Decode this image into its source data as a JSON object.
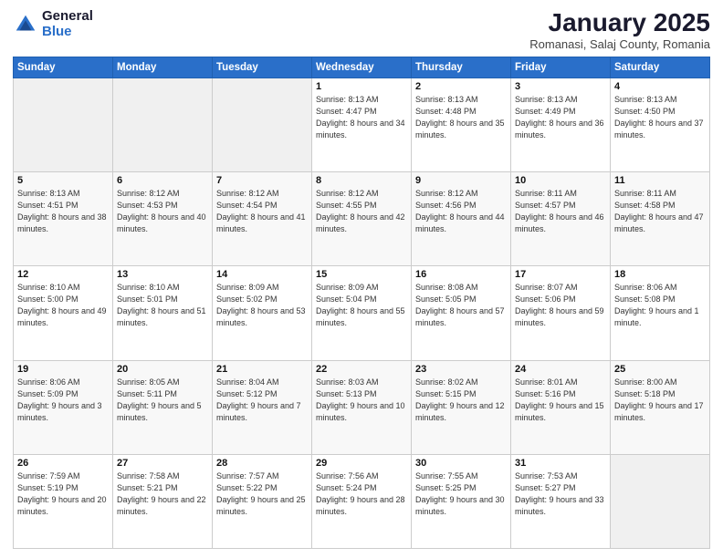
{
  "header": {
    "logo_general": "General",
    "logo_blue": "Blue",
    "month_title": "January 2025",
    "location": "Romanasi, Salaj County, Romania"
  },
  "days_of_week": [
    "Sunday",
    "Monday",
    "Tuesday",
    "Wednesday",
    "Thursday",
    "Friday",
    "Saturday"
  ],
  "weeks": [
    [
      {
        "day": "",
        "sunrise": "",
        "sunset": "",
        "daylight": "",
        "empty": true
      },
      {
        "day": "",
        "sunrise": "",
        "sunset": "",
        "daylight": "",
        "empty": true
      },
      {
        "day": "",
        "sunrise": "",
        "sunset": "",
        "daylight": "",
        "empty": true
      },
      {
        "day": "1",
        "sunrise": "Sunrise: 8:13 AM",
        "sunset": "Sunset: 4:47 PM",
        "daylight": "Daylight: 8 hours and 34 minutes."
      },
      {
        "day": "2",
        "sunrise": "Sunrise: 8:13 AM",
        "sunset": "Sunset: 4:48 PM",
        "daylight": "Daylight: 8 hours and 35 minutes."
      },
      {
        "day": "3",
        "sunrise": "Sunrise: 8:13 AM",
        "sunset": "Sunset: 4:49 PM",
        "daylight": "Daylight: 8 hours and 36 minutes."
      },
      {
        "day": "4",
        "sunrise": "Sunrise: 8:13 AM",
        "sunset": "Sunset: 4:50 PM",
        "daylight": "Daylight: 8 hours and 37 minutes."
      }
    ],
    [
      {
        "day": "5",
        "sunrise": "Sunrise: 8:13 AM",
        "sunset": "Sunset: 4:51 PM",
        "daylight": "Daylight: 8 hours and 38 minutes."
      },
      {
        "day": "6",
        "sunrise": "Sunrise: 8:12 AM",
        "sunset": "Sunset: 4:53 PM",
        "daylight": "Daylight: 8 hours and 40 minutes."
      },
      {
        "day": "7",
        "sunrise": "Sunrise: 8:12 AM",
        "sunset": "Sunset: 4:54 PM",
        "daylight": "Daylight: 8 hours and 41 minutes."
      },
      {
        "day": "8",
        "sunrise": "Sunrise: 8:12 AM",
        "sunset": "Sunset: 4:55 PM",
        "daylight": "Daylight: 8 hours and 42 minutes."
      },
      {
        "day": "9",
        "sunrise": "Sunrise: 8:12 AM",
        "sunset": "Sunset: 4:56 PM",
        "daylight": "Daylight: 8 hours and 44 minutes."
      },
      {
        "day": "10",
        "sunrise": "Sunrise: 8:11 AM",
        "sunset": "Sunset: 4:57 PM",
        "daylight": "Daylight: 8 hours and 46 minutes."
      },
      {
        "day": "11",
        "sunrise": "Sunrise: 8:11 AM",
        "sunset": "Sunset: 4:58 PM",
        "daylight": "Daylight: 8 hours and 47 minutes."
      }
    ],
    [
      {
        "day": "12",
        "sunrise": "Sunrise: 8:10 AM",
        "sunset": "Sunset: 5:00 PM",
        "daylight": "Daylight: 8 hours and 49 minutes."
      },
      {
        "day": "13",
        "sunrise": "Sunrise: 8:10 AM",
        "sunset": "Sunset: 5:01 PM",
        "daylight": "Daylight: 8 hours and 51 minutes."
      },
      {
        "day": "14",
        "sunrise": "Sunrise: 8:09 AM",
        "sunset": "Sunset: 5:02 PM",
        "daylight": "Daylight: 8 hours and 53 minutes."
      },
      {
        "day": "15",
        "sunrise": "Sunrise: 8:09 AM",
        "sunset": "Sunset: 5:04 PM",
        "daylight": "Daylight: 8 hours and 55 minutes."
      },
      {
        "day": "16",
        "sunrise": "Sunrise: 8:08 AM",
        "sunset": "Sunset: 5:05 PM",
        "daylight": "Daylight: 8 hours and 57 minutes."
      },
      {
        "day": "17",
        "sunrise": "Sunrise: 8:07 AM",
        "sunset": "Sunset: 5:06 PM",
        "daylight": "Daylight: 8 hours and 59 minutes."
      },
      {
        "day": "18",
        "sunrise": "Sunrise: 8:06 AM",
        "sunset": "Sunset: 5:08 PM",
        "daylight": "Daylight: 9 hours and 1 minute."
      }
    ],
    [
      {
        "day": "19",
        "sunrise": "Sunrise: 8:06 AM",
        "sunset": "Sunset: 5:09 PM",
        "daylight": "Daylight: 9 hours and 3 minutes."
      },
      {
        "day": "20",
        "sunrise": "Sunrise: 8:05 AM",
        "sunset": "Sunset: 5:11 PM",
        "daylight": "Daylight: 9 hours and 5 minutes."
      },
      {
        "day": "21",
        "sunrise": "Sunrise: 8:04 AM",
        "sunset": "Sunset: 5:12 PM",
        "daylight": "Daylight: 9 hours and 7 minutes."
      },
      {
        "day": "22",
        "sunrise": "Sunrise: 8:03 AM",
        "sunset": "Sunset: 5:13 PM",
        "daylight": "Daylight: 9 hours and 10 minutes."
      },
      {
        "day": "23",
        "sunrise": "Sunrise: 8:02 AM",
        "sunset": "Sunset: 5:15 PM",
        "daylight": "Daylight: 9 hours and 12 minutes."
      },
      {
        "day": "24",
        "sunrise": "Sunrise: 8:01 AM",
        "sunset": "Sunset: 5:16 PM",
        "daylight": "Daylight: 9 hours and 15 minutes."
      },
      {
        "day": "25",
        "sunrise": "Sunrise: 8:00 AM",
        "sunset": "Sunset: 5:18 PM",
        "daylight": "Daylight: 9 hours and 17 minutes."
      }
    ],
    [
      {
        "day": "26",
        "sunrise": "Sunrise: 7:59 AM",
        "sunset": "Sunset: 5:19 PM",
        "daylight": "Daylight: 9 hours and 20 minutes."
      },
      {
        "day": "27",
        "sunrise": "Sunrise: 7:58 AM",
        "sunset": "Sunset: 5:21 PM",
        "daylight": "Daylight: 9 hours and 22 minutes."
      },
      {
        "day": "28",
        "sunrise": "Sunrise: 7:57 AM",
        "sunset": "Sunset: 5:22 PM",
        "daylight": "Daylight: 9 hours and 25 minutes."
      },
      {
        "day": "29",
        "sunrise": "Sunrise: 7:56 AM",
        "sunset": "Sunset: 5:24 PM",
        "daylight": "Daylight: 9 hours and 28 minutes."
      },
      {
        "day": "30",
        "sunrise": "Sunrise: 7:55 AM",
        "sunset": "Sunset: 5:25 PM",
        "daylight": "Daylight: 9 hours and 30 minutes."
      },
      {
        "day": "31",
        "sunrise": "Sunrise: 7:53 AM",
        "sunset": "Sunset: 5:27 PM",
        "daylight": "Daylight: 9 hours and 33 minutes."
      },
      {
        "day": "",
        "sunrise": "",
        "sunset": "",
        "daylight": "",
        "empty": true
      }
    ]
  ]
}
